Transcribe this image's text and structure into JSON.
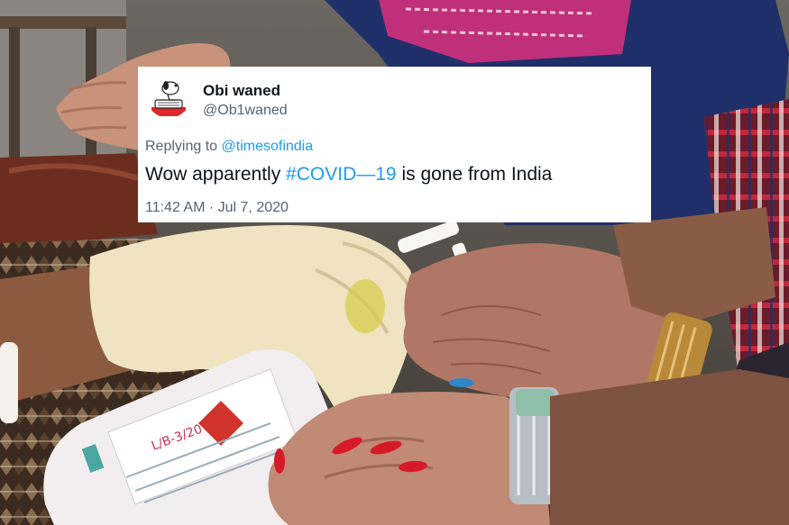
{
  "tweet": {
    "display_name": "Obi waned",
    "handle": "@Ob1waned",
    "replying_prefix": "Replying to",
    "replying_to": "@timesofindia",
    "text_before": "Wow apparently",
    "hashtag": "#COVID—19",
    "text_after": "is gone from India",
    "timestamp": "11:42 AM · Jul 7, 2020",
    "link_color": "#1d9bf0"
  },
  "photo": {
    "description_icons": [
      "gloved-hand",
      "sanitizer-bottle",
      "open-palm",
      "wristwatch",
      "red-nails"
    ]
  }
}
